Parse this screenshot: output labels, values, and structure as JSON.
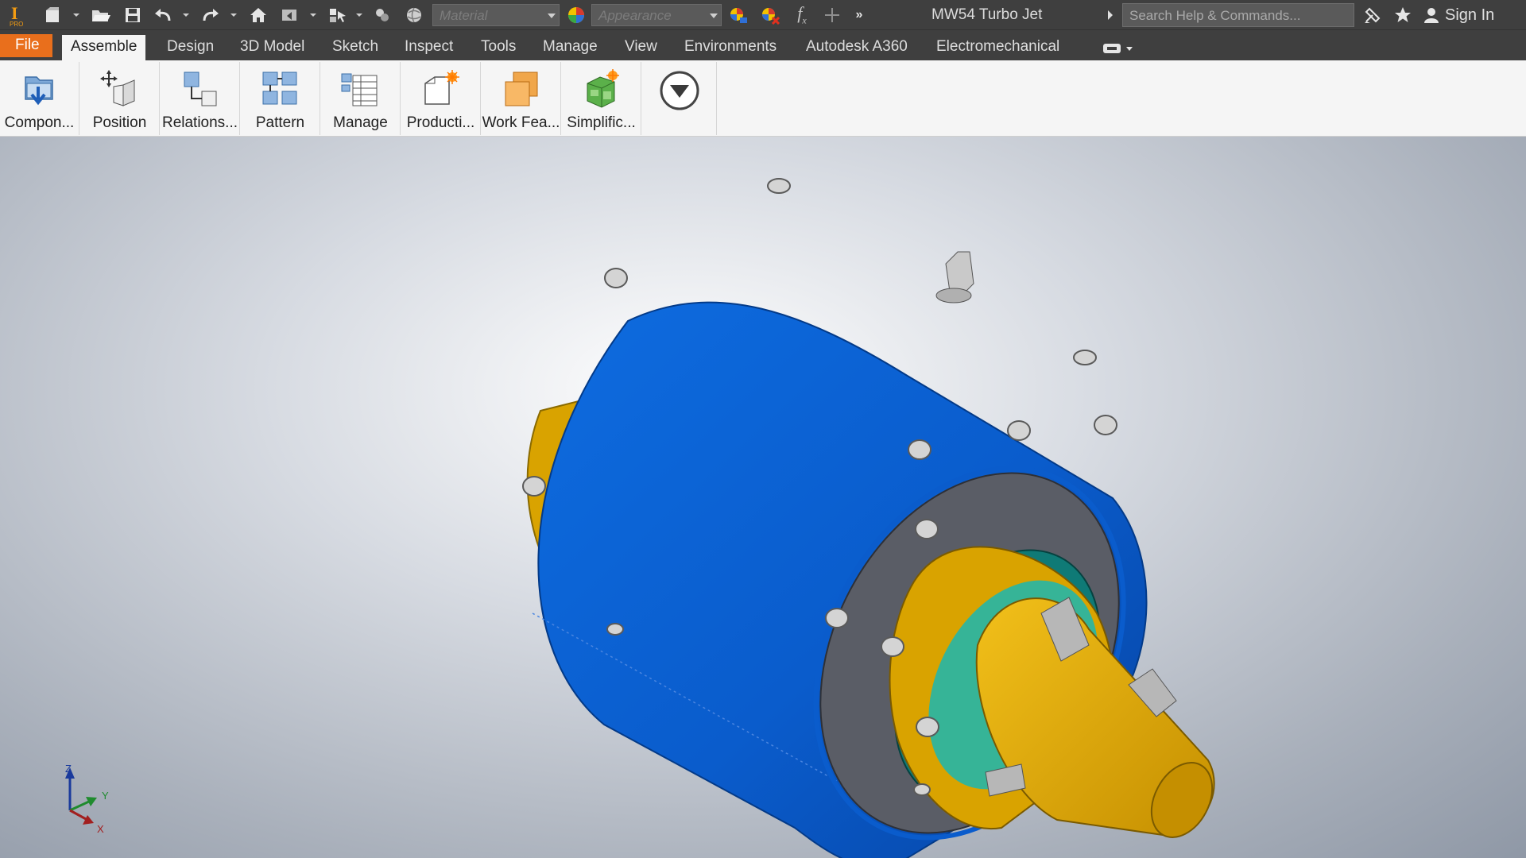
{
  "app": {
    "logo_letter": "I",
    "logo_sub": "PRO"
  },
  "quick_access": {
    "material_placeholder": "Material",
    "appearance_placeholder": "Appearance",
    "fx_label": "f",
    "fx_sub": "x",
    "overflow_label": "»"
  },
  "document": {
    "title": "MW54 Turbo Jet"
  },
  "search": {
    "placeholder": "Search Help & Commands..."
  },
  "account": {
    "sign_in_label": "Sign In"
  },
  "ribbon_tabs": [
    {
      "label": "File"
    },
    {
      "label": "Assemble",
      "active": true
    },
    {
      "label": "Design"
    },
    {
      "label": "3D Model"
    },
    {
      "label": "Sketch"
    },
    {
      "label": "Inspect"
    },
    {
      "label": "Tools"
    },
    {
      "label": "Manage"
    },
    {
      "label": "View"
    },
    {
      "label": "Environments"
    },
    {
      "label": "Autodesk A360"
    },
    {
      "label": "Electromechanical"
    }
  ],
  "ribbon_panels": [
    {
      "label": "Compon...",
      "icon": "place-component-icon"
    },
    {
      "label": "Position",
      "icon": "move-position-icon"
    },
    {
      "label": "Relations...",
      "icon": "constraint-relationships-icon"
    },
    {
      "label": "Pattern",
      "icon": "pattern-icon"
    },
    {
      "label": "Manage",
      "icon": "bill-of-materials-icon"
    },
    {
      "label": "Producti...",
      "icon": "productivity-icon"
    },
    {
      "label": "Work Fea...",
      "icon": "work-features-icon"
    },
    {
      "label": "Simplific...",
      "icon": "simplification-icon"
    }
  ],
  "viewport": {
    "model_name": "MW54 Turbo Jet",
    "colors": {
      "casing": "#0a5ccc",
      "nozzle": "#e1a900",
      "flange": "#5a5d66",
      "turbine": "#19b7b2"
    }
  },
  "axis_triad": {
    "x_label": "X",
    "y_label": "Y",
    "z_label": "Z"
  },
  "theme": {
    "accent": "#e96f1c",
    "title_bar": "#3f3f3f",
    "ribbon": "#f5f5f5"
  }
}
